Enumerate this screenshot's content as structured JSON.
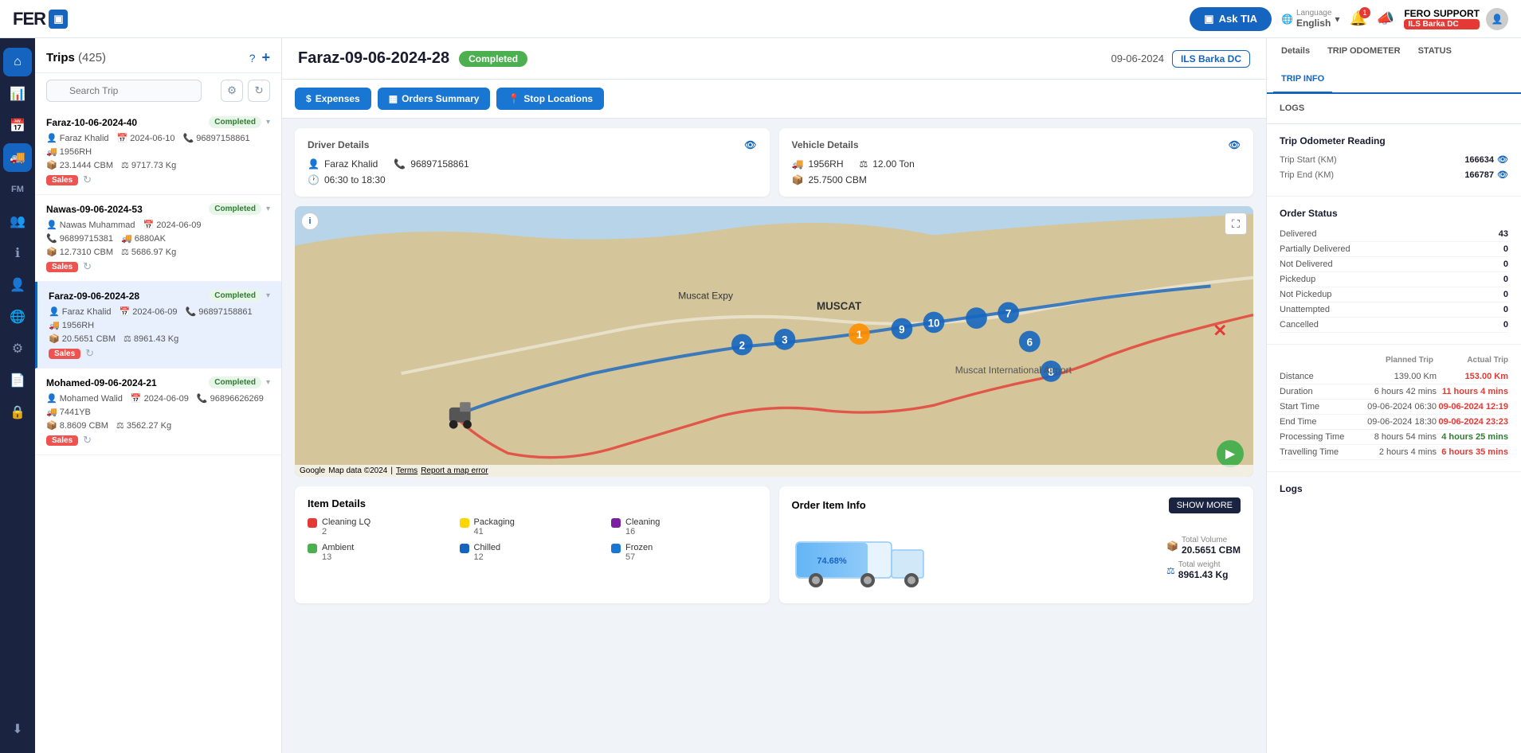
{
  "nav": {
    "logo_text": "FER",
    "logo_box": "▣",
    "ask_tia": "Ask TIA",
    "language_label": "Language",
    "language_value": "English",
    "notif_count": "1",
    "support_name": "FERO SUPPORT",
    "support_badge": "ILS Barka DC"
  },
  "sidebar_icons": [
    {
      "name": "home-icon",
      "icon": "⌂"
    },
    {
      "name": "chart-icon",
      "icon": "📊"
    },
    {
      "name": "calendar-icon",
      "icon": "📅"
    },
    {
      "name": "truck-icon",
      "icon": "🚚",
      "active": true
    },
    {
      "name": "fm-icon",
      "icon": "FM"
    },
    {
      "name": "users-icon",
      "icon": "👥"
    },
    {
      "name": "info-icon",
      "icon": "ℹ"
    },
    {
      "name": "people-icon",
      "icon": "👤"
    },
    {
      "name": "globe-icon",
      "icon": "🌐"
    },
    {
      "name": "settings-icon",
      "icon": "⚙"
    },
    {
      "name": "file-icon",
      "icon": "📄"
    },
    {
      "name": "lock-icon",
      "icon": "🔒"
    },
    {
      "name": "download-icon",
      "icon": "⬇"
    }
  ],
  "trips_panel": {
    "title": "Trips",
    "count": "(425)",
    "search_placeholder": "Search Trip",
    "trips": [
      {
        "id": "Faraz-10-06-2024-40",
        "status": "Completed",
        "status_type": "completed",
        "driver": "Faraz Khalid",
        "date": "2024-06-10",
        "phone": "96897158861",
        "vehicle": "1956RH",
        "cbm": "23.1444 CBM",
        "weight": "9717.73 Kg",
        "tag": "Sales",
        "active": false
      },
      {
        "id": "Nawas-09-06-2024-53",
        "status": "Completed",
        "status_type": "completed",
        "driver": "Nawas Muhammad",
        "date": "2024-06-09",
        "phone": "96899715381",
        "vehicle": "6880AK",
        "cbm": "12.7310 CBM",
        "weight": "5686.97 Kg",
        "tag": "Sales",
        "active": false
      },
      {
        "id": "Faraz-09-06-2024-28",
        "status": "Completed",
        "status_type": "completed",
        "driver": "Faraz Khalid",
        "date": "2024-06-09",
        "phone": "96897158861",
        "vehicle": "1956RH",
        "cbm": "20.5651 CBM",
        "weight": "8961.43 Kg",
        "tag": "Sales",
        "active": true
      },
      {
        "id": "Mohamed-09-06-2024-21",
        "status": "Completed",
        "status_type": "completed",
        "driver": "Mohamed Walid",
        "date": "2024-06-09",
        "phone": "96896626269",
        "vehicle": "7441YB",
        "cbm": "8.8609 CBM",
        "weight": "3562.27 Kg",
        "tag": "Sales",
        "active": false
      }
    ]
  },
  "trip_detail": {
    "trip_id": "Faraz-09-06-2024-28",
    "status": "Completed",
    "date": "09-06-2024",
    "branch": "ILS Barka DC",
    "buttons": {
      "expenses": "Expenses",
      "orders_summary": "Orders Summary",
      "stop_locations": "Stop Locations"
    },
    "driver_details": {
      "title": "Driver Details",
      "name": "Faraz Khalid",
      "phone": "96897158861",
      "time": "06:30 to 18:30"
    },
    "vehicle_details": {
      "title": "Vehicle Details",
      "vehicle_id": "1956RH",
      "weight": "12.00 Ton",
      "cbm": "25.7500 CBM"
    },
    "item_details": {
      "title": "Item Details",
      "items": [
        {
          "label": "Cleaning LQ",
          "count": "2",
          "color": "#e53935"
        },
        {
          "label": "Packaging",
          "count": "41",
          "color": "#ffd600"
        },
        {
          "label": "Cleaning",
          "count": "16",
          "color": "#7b1fa2"
        },
        {
          "label": "Ambient",
          "count": "13",
          "color": "#4caf50"
        },
        {
          "label": "Chilled",
          "count": "12",
          "color": "#1565c0"
        },
        {
          "label": "Frozen",
          "count": "57",
          "color": "#1976d2"
        }
      ]
    },
    "order_item_info": {
      "title": "Order Item Info",
      "show_more": "SHOW MORE",
      "fill_percent": "74.68%",
      "fill_value": 74.68,
      "total_volume_label": "Total Volume",
      "total_volume": "20.5651 CBM",
      "total_weight_label": "Total weight",
      "total_weight": "8961.43 Kg"
    },
    "map": {
      "attribution": "Google",
      "map_data": "Map data ©2024",
      "terms": "Terms",
      "report": "Report a map error"
    }
  },
  "right_panel": {
    "tabs": [
      "Details",
      "TRIP ODOMETER",
      "STATUS",
      "TRIP INFO",
      "LOGS"
    ],
    "active_tab": "TRIP INFO",
    "trip_odometer": {
      "title": "Trip Odometer Reading",
      "trip_start_label": "Trip Start (KM)",
      "trip_start_value": "166634",
      "trip_end_label": "Trip End (KM)",
      "trip_end_value": "166787"
    },
    "order_status": {
      "title": "Order Status",
      "rows": [
        {
          "label": "Delivered",
          "value": "43"
        },
        {
          "label": "Partially Delivered",
          "value": "0"
        },
        {
          "label": "Not Delivered",
          "value": "0"
        },
        {
          "label": "Pickedup",
          "value": "0"
        },
        {
          "label": "Not Pickedup",
          "value": "0"
        },
        {
          "label": "Unattempted",
          "value": "0"
        },
        {
          "label": "Cancelled",
          "value": "0"
        }
      ]
    },
    "trip_compare": {
      "col_planned": "Planned Trip",
      "col_actual": "Actual Trip",
      "rows": [
        {
          "label": "Distance",
          "planned": "139.00 Km",
          "actual": "153.00 Km",
          "actual_color": "red"
        },
        {
          "label": "Duration",
          "planned": "6 hours 42 mins",
          "actual": "11 hours 4 mins",
          "actual_color": "red"
        },
        {
          "label": "Start Time",
          "planned": "09-06-2024 06:30",
          "actual": "09-06-2024 12:19",
          "actual_color": "red"
        },
        {
          "label": "End Time",
          "planned": "09-06-2024 18:30",
          "actual": "09-06-2024 23:23",
          "actual_color": "red"
        },
        {
          "label": "Processing Time",
          "planned": "8 hours 54 mins",
          "actual": "4 hours 25 mins",
          "actual_color": "green"
        },
        {
          "label": "Travelling Time",
          "planned": "2 hours 4 mins",
          "actual": "6 hours 35 mins",
          "actual_color": "red"
        }
      ]
    },
    "logs": {
      "title": "Logs"
    }
  }
}
